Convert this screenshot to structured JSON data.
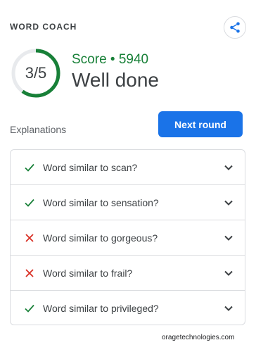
{
  "header": {
    "title": "WORD COACH"
  },
  "share": {
    "icon": "share-icon",
    "color": "#1a73e8"
  },
  "score": {
    "ring_text": "3/5",
    "fraction": 0.6,
    "line": "Score • 5940",
    "headline": "Well done",
    "ring_color": "#188038"
  },
  "explanations_label": "Explanations",
  "next_round_label": "Next round",
  "items": [
    {
      "question": "Word similar to scan?",
      "correct": true
    },
    {
      "question": "Word similar to sensation?",
      "correct": true
    },
    {
      "question": "Word similar to gorgeous?",
      "correct": false
    },
    {
      "question": "Word similar to frail?",
      "correct": false
    },
    {
      "question": "Word similar to privileged?",
      "correct": true
    }
  ],
  "colors": {
    "correct": "#188038",
    "wrong": "#d93025",
    "accent": "#1a73e8"
  },
  "watermark": "oragetechnologies.com"
}
